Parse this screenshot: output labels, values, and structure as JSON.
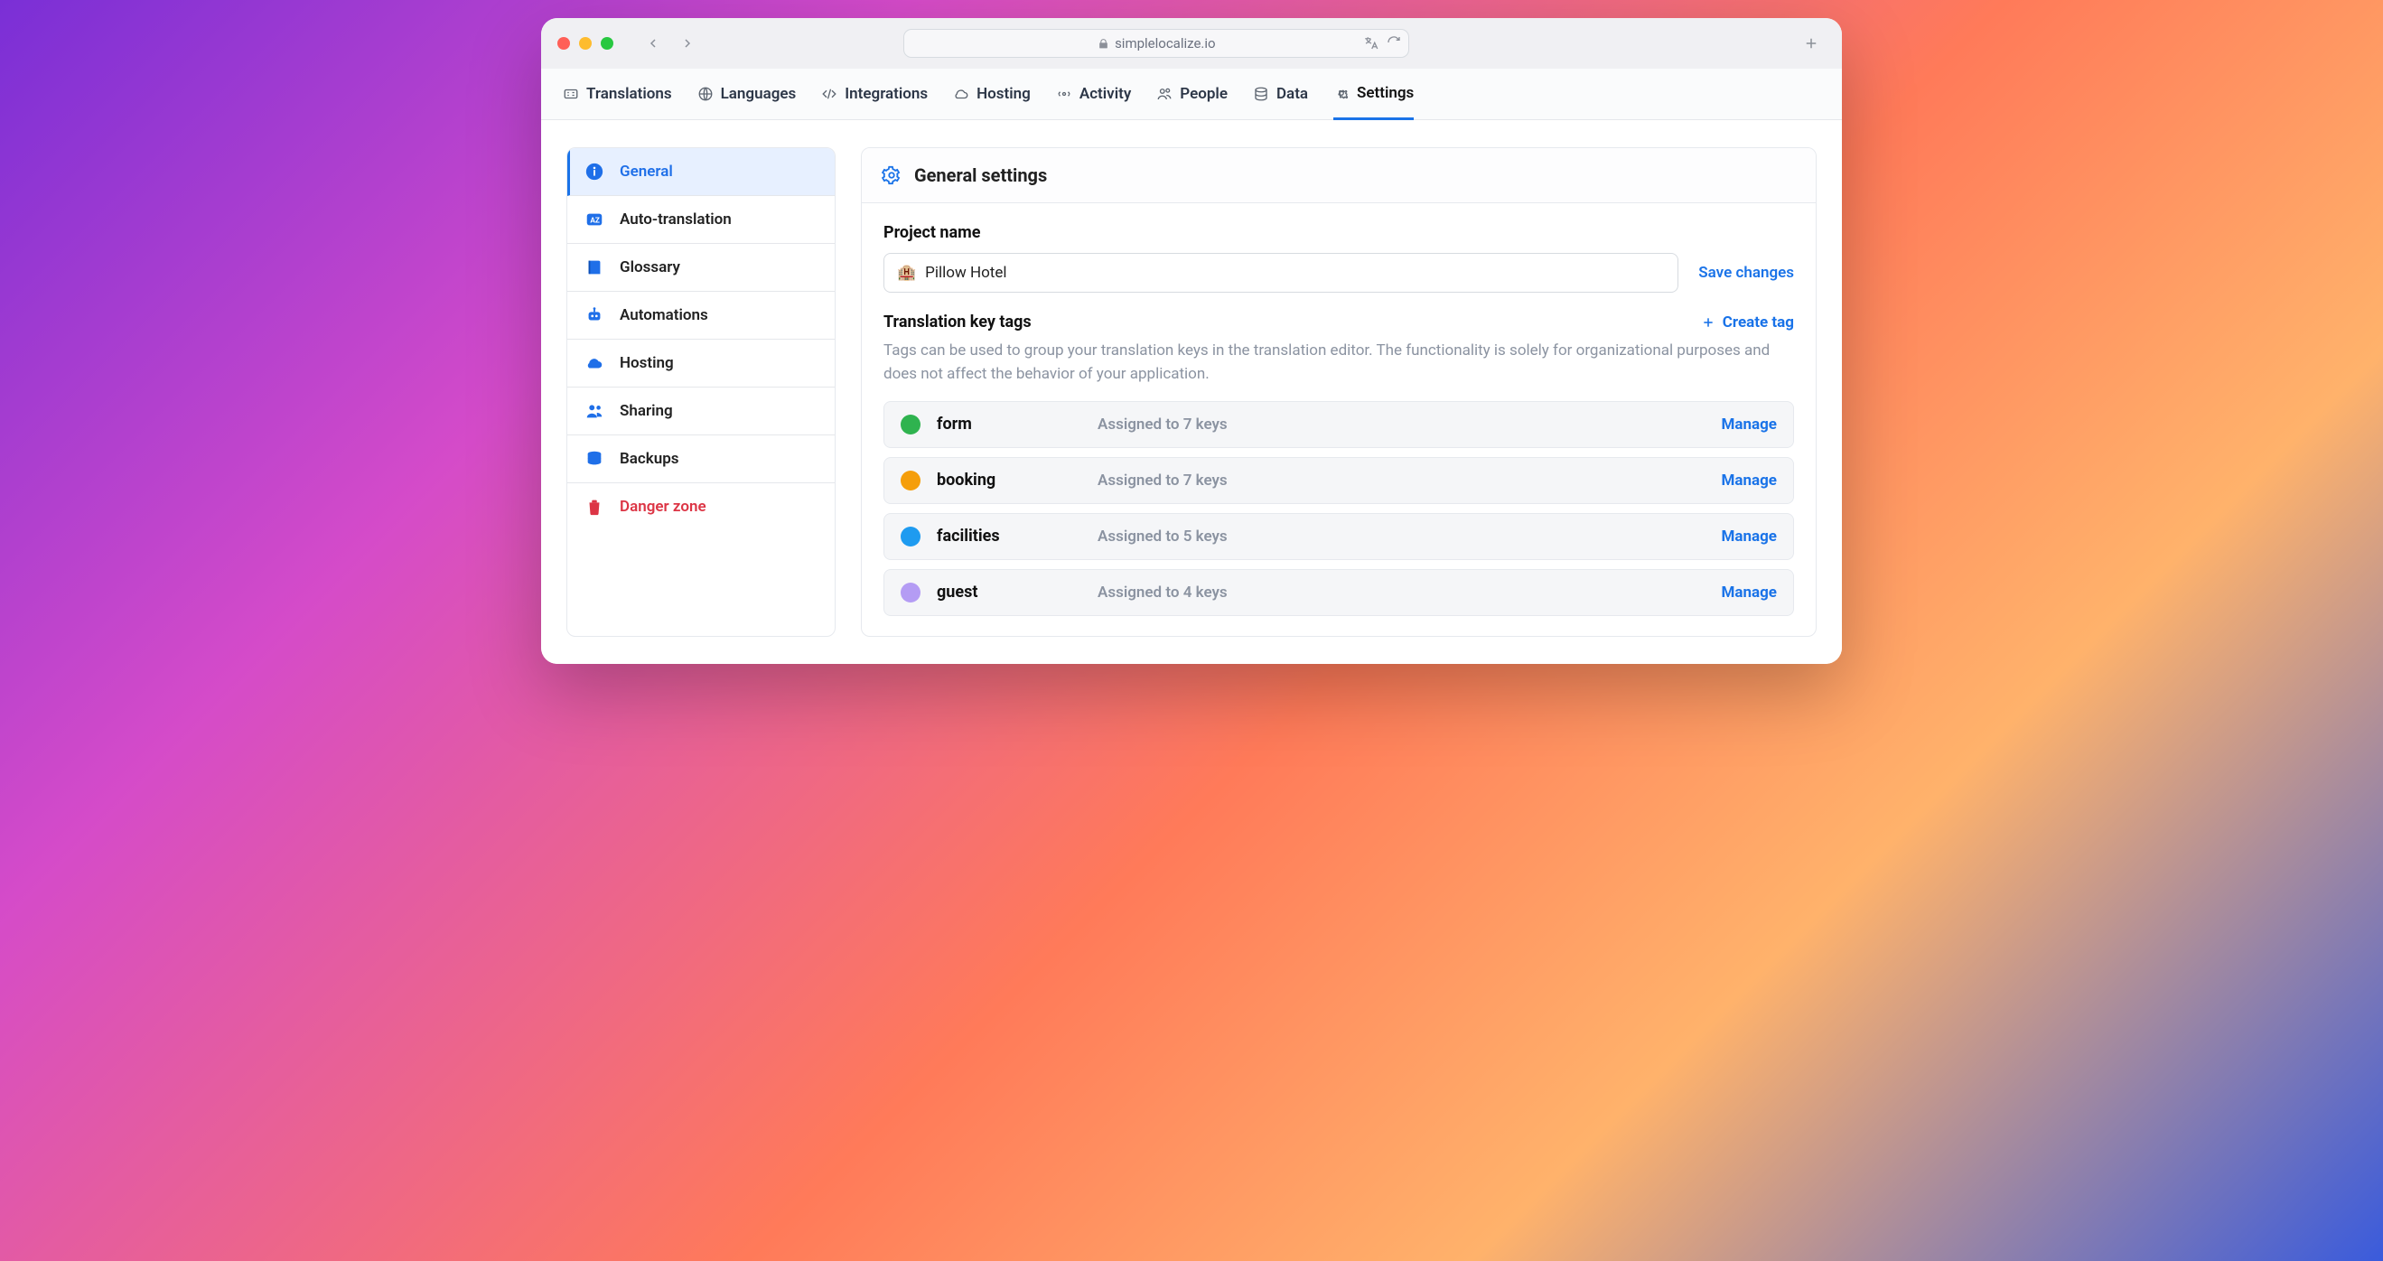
{
  "browser": {
    "domain": "simplelocalize.io"
  },
  "topnav": {
    "tabs": [
      {
        "label": "Translations"
      },
      {
        "label": "Languages"
      },
      {
        "label": "Integrations"
      },
      {
        "label": "Hosting"
      },
      {
        "label": "Activity"
      },
      {
        "label": "People"
      },
      {
        "label": "Data"
      },
      {
        "label": "Settings"
      }
    ],
    "active": "Settings"
  },
  "sidebar": {
    "items": [
      {
        "label": "General",
        "danger": false,
        "active": true
      },
      {
        "label": "Auto-translation",
        "danger": false,
        "active": false
      },
      {
        "label": "Glossary",
        "danger": false,
        "active": false
      },
      {
        "label": "Automations",
        "danger": false,
        "active": false
      },
      {
        "label": "Hosting",
        "danger": false,
        "active": false
      },
      {
        "label": "Sharing",
        "danger": false,
        "active": false
      },
      {
        "label": "Backups",
        "danger": false,
        "active": false
      },
      {
        "label": "Danger zone",
        "danger": true,
        "active": false
      }
    ]
  },
  "main": {
    "title": "General settings",
    "project_name": {
      "label": "Project name",
      "value": "Pillow Hotel",
      "emoji": "🏨",
      "save_label": "Save changes"
    },
    "tags_section": {
      "heading": "Translation key tags",
      "create_label": "Create tag",
      "description": "Tags can be used to group your translation keys in the translation editor. The functionality is solely for organizational purposes and does not affect the behavior of your application.",
      "manage_label": "Manage",
      "assigned_prefix": "Assigned to ",
      "assigned_suffix": " keys",
      "tags": [
        {
          "name": "form",
          "count": 7,
          "color": "#2fb34f"
        },
        {
          "name": "booking",
          "count": 7,
          "color": "#f59e0b"
        },
        {
          "name": "facilities",
          "count": 5,
          "color": "#1e9bf0"
        },
        {
          "name": "guest",
          "count": 4,
          "color": "#b49cf4"
        }
      ]
    }
  }
}
